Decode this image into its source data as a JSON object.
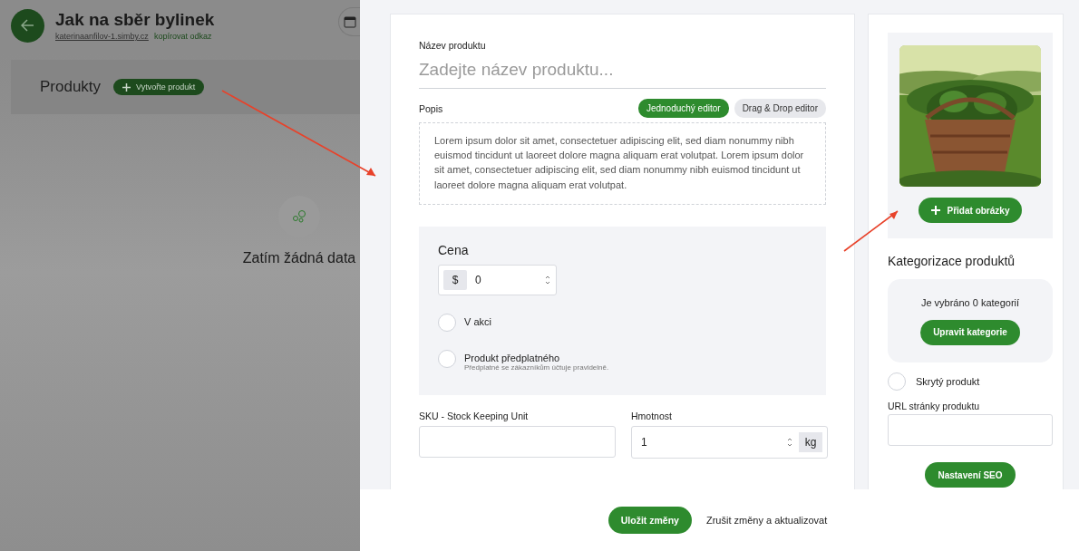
{
  "background_page": {
    "title": "Jak na sběr bylinek",
    "domain": "katerinaanfilov-1.simby.cz",
    "copy_link": "kopírovat odkaz",
    "section_title": "Produkty",
    "create_button": "Vytvořte produkt",
    "empty_text": "Zatím žádná data"
  },
  "product_form": {
    "name_label": "Název produktu",
    "name_placeholder": "Zadejte název produktu...",
    "description_label": "Popis",
    "editor_modes": [
      {
        "label": "Jednoduchý editor",
        "selected": true
      },
      {
        "label": "Drag & Drop editor",
        "selected": false
      }
    ],
    "description_text": "Lorem ipsum dolor sit amet, consectetuer adipiscing elit, sed diam nonummy nibh euismod tincidunt ut laoreet dolore magna aliquam erat volutpat. Lorem ipsum dolor sit amet, consectetuer adipiscing elit, sed diam nonummy nibh euismod tincidunt ut laoreet dolore magna aliquam erat volutpat.",
    "price": {
      "title": "Cena",
      "currency": "$",
      "value": "0"
    },
    "options": [
      {
        "label": "V akci",
        "checked": false
      },
      {
        "label": "Produkt předplatného",
        "hint": "Předplatné se zákazníkům účtuje pravidelně.",
        "checked": false
      }
    ],
    "sku": {
      "label": "SKU - Stock Keeping Unit"
    },
    "weight": {
      "label": "Hmotnost",
      "value": "1",
      "unit": "kg"
    }
  },
  "sidebar": {
    "add_images_button": "Přidat obrázky",
    "categorization_title": "Kategorizace produktů",
    "categories_text": "Je vybráno 0 kategorií",
    "edit_categories_button": "Upravit kategorie",
    "hidden_product": {
      "label": "Skrytý produkt",
      "checked": false
    },
    "url_label": "URL stránky produktu",
    "seo_button": "Nastavení SEO"
  },
  "footer": {
    "save_button": "Uložit změny",
    "cancel_link": "Zrušit změny a aktualizovat"
  }
}
